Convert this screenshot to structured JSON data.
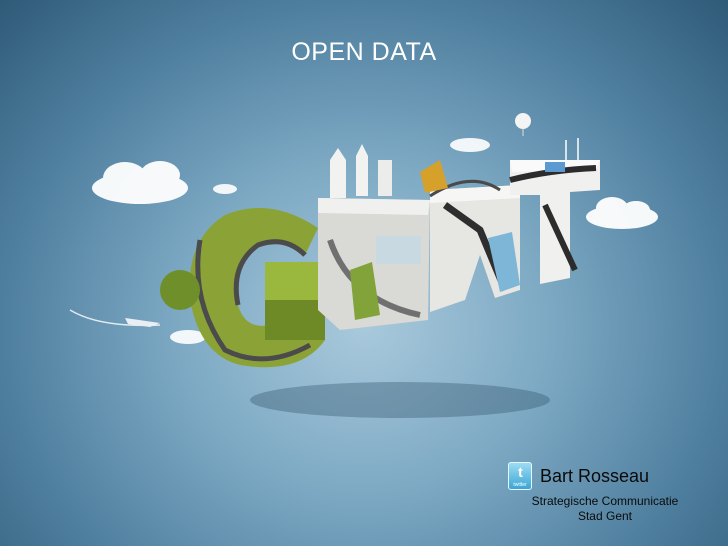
{
  "slide": {
    "title": "OPEN DATA",
    "illustration_text": "GENT",
    "author": {
      "name": "Bart Rosseau",
      "role": "Strategische Communicatie",
      "organization": "Stad Gent",
      "icon": "twitter-icon",
      "icon_label": "twitter"
    }
  },
  "colors": {
    "background": "#7eaac4",
    "title": "#ffffff",
    "text": "#0a0a0a"
  }
}
